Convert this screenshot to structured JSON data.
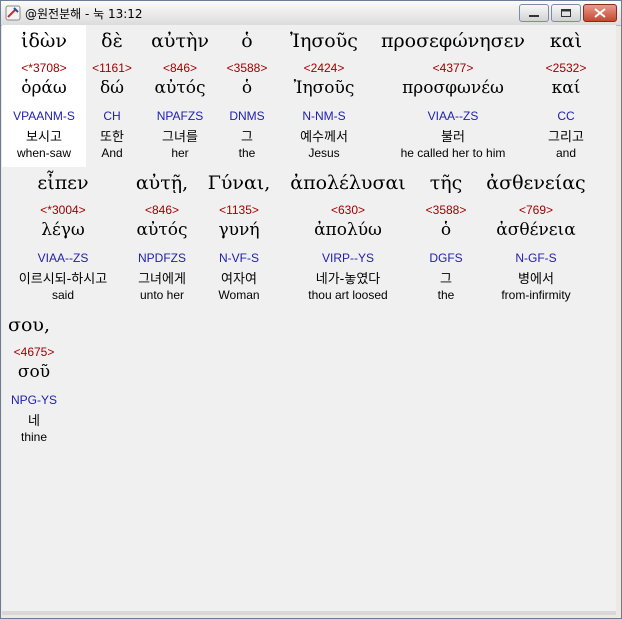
{
  "window": {
    "title": "@원전분해 - 눅 13:12"
  },
  "words": [
    {
      "greek": "ἰδὼν",
      "strong": "<*3708>",
      "lemma": "ὁράω",
      "morph": "VPAANM-S",
      "korean": "보시고",
      "english": "when-saw"
    },
    {
      "greek": "δὲ",
      "strong": "<1161>",
      "lemma": "δώ",
      "morph": "CH",
      "korean": "또한",
      "english": "And"
    },
    {
      "greek": "αὐτὴν",
      "strong": "<846>",
      "lemma": "αὐτός",
      "morph": "NPAFZS",
      "korean": "그녀를",
      "english": "her"
    },
    {
      "greek": "ὁ",
      "strong": "<3588>",
      "lemma": "ὁ",
      "morph": "DNMS",
      "korean": "그",
      "english": "the"
    },
    {
      "greek": "Ἰησοῦς",
      "strong": "<2424>",
      "lemma": "Ἰησοῦς",
      "morph": "N-NM-S",
      "korean": "예수께서",
      "english": "Jesus"
    },
    {
      "greek": "προσεφώνησεν",
      "strong": "<4377>",
      "lemma": "προσφωνέω",
      "morph": "VIAA--ZS",
      "korean": "불러",
      "english": "he called her to him"
    },
    {
      "greek": "καὶ",
      "strong": "<2532>",
      "lemma": "καί",
      "morph": "CC",
      "korean": "그리고",
      "english": "and"
    },
    {
      "greek": "εἶπεν",
      "strong": "<*3004>",
      "lemma": "λέγω",
      "morph": "VIAA--ZS",
      "korean": "이르시되-하시고",
      "english": "said"
    },
    {
      "greek": "αὐτῇ,",
      "strong": "<846>",
      "lemma": "αὐτός",
      "morph": "NPDFZS",
      "korean": "그녀에게",
      "english": "unto her"
    },
    {
      "greek": "Γύναι,",
      "strong": "<1135>",
      "lemma": "γυνή",
      "morph": "N-VF-S",
      "korean": "여자여",
      "english": "Woman"
    },
    {
      "greek": "ἀπολέλυσαι",
      "strong": "<630>",
      "lemma": "ἀπολύω",
      "morph": "VIRP--YS",
      "korean": "네가-놓였다",
      "english": "thou art loosed"
    },
    {
      "greek": "τῆς",
      "strong": "<3588>",
      "lemma": "ὁ",
      "morph": "DGFS",
      "korean": "그",
      "english": "the"
    },
    {
      "greek": "ἀσθενείας",
      "strong": "<769>",
      "lemma": "ἀσθένεια",
      "morph": "N-GF-S",
      "korean": "병에서",
      "english": "from-infirmity"
    },
    {
      "greek": "σου,",
      "strong": "<4675>",
      "lemma": "σοῦ",
      "morph": "NPG-YS",
      "korean": "네",
      "english": "thine"
    }
  ]
}
